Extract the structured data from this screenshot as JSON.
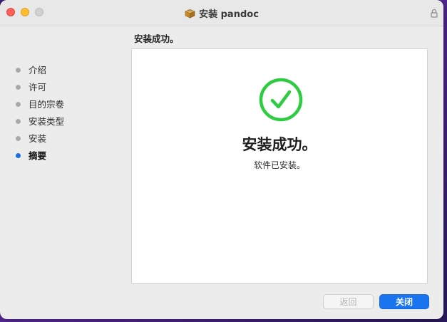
{
  "window": {
    "title": "安装 pandoc"
  },
  "sidebar": {
    "steps": [
      {
        "label": "介绍",
        "active": false
      },
      {
        "label": "许可",
        "active": false
      },
      {
        "label": "目的宗卷",
        "active": false
      },
      {
        "label": "安装类型",
        "active": false
      },
      {
        "label": "安装",
        "active": false
      },
      {
        "label": "摘要",
        "active": true
      }
    ]
  },
  "main": {
    "header": "安装成功。",
    "success_title": "安装成功。",
    "success_subtitle": "软件已安装。"
  },
  "buttons": {
    "back_label": "返回",
    "close_label": "关闭"
  },
  "colors": {
    "accent": "#1a74f0",
    "success": "#2ecc40",
    "active_dot": "#1e6fe6"
  },
  "icons": {
    "title_icon": "package-icon",
    "lock_icon": "lock-icon",
    "success_icon": "checkmark-circle-icon"
  }
}
